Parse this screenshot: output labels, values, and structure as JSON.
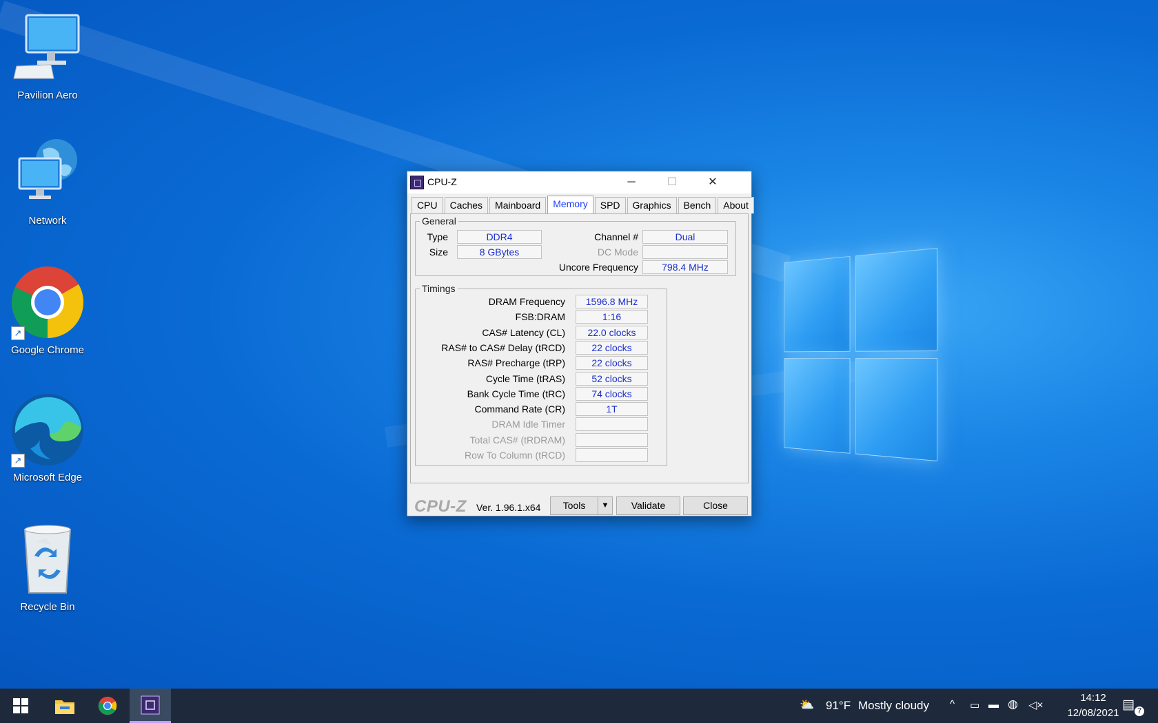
{
  "desktop": {
    "icons": [
      {
        "label": "Pavilion Aero",
        "icon": "computer-icon"
      },
      {
        "label": "Network",
        "icon": "network-icon"
      },
      {
        "label": "Google Chrome",
        "icon": "chrome-icon"
      },
      {
        "label": "Microsoft Edge",
        "icon": "edge-icon"
      },
      {
        "label": "Recycle Bin",
        "icon": "recycle-bin-icon"
      }
    ]
  },
  "window": {
    "title": "CPU-Z",
    "controls": {
      "minimize": "─",
      "maximize": "☐",
      "close": "✕"
    },
    "tabs": [
      "CPU",
      "Caches",
      "Mainboard",
      "Memory",
      "SPD",
      "Graphics",
      "Bench",
      "About"
    ],
    "active_tab": "Memory",
    "general": {
      "legend": "General",
      "type_label": "Type",
      "type_value": "DDR4",
      "size_label": "Size",
      "size_value": "8 GBytes",
      "channel_label": "Channel #",
      "channel_value": "Dual",
      "dcmode_label": "DC Mode",
      "dcmode_value": "",
      "uncore_label": "Uncore Frequency",
      "uncore_value": "798.4 MHz"
    },
    "timings": {
      "legend": "Timings",
      "rows": [
        {
          "label": "DRAM Frequency",
          "value": "1596.8 MHz",
          "enabled": true
        },
        {
          "label": "FSB:DRAM",
          "value": "1:16",
          "enabled": true
        },
        {
          "label": "CAS# Latency (CL)",
          "value": "22.0 clocks",
          "enabled": true
        },
        {
          "label": "RAS# to CAS# Delay (tRCD)",
          "value": "22 clocks",
          "enabled": true
        },
        {
          "label": "RAS# Precharge (tRP)",
          "value": "22 clocks",
          "enabled": true
        },
        {
          "label": "Cycle Time (tRAS)",
          "value": "52 clocks",
          "enabled": true
        },
        {
          "label": "Bank Cycle Time (tRC)",
          "value": "74 clocks",
          "enabled": true
        },
        {
          "label": "Command Rate (CR)",
          "value": "1T",
          "enabled": true
        },
        {
          "label": "DRAM Idle Timer",
          "value": "",
          "enabled": false
        },
        {
          "label": "Total CAS# (tRDRAM)",
          "value": "",
          "enabled": false
        },
        {
          "label": "Row To Column (tRCD)",
          "value": "",
          "enabled": false
        }
      ]
    },
    "footer": {
      "brand": "CPU-Z",
      "version": "Ver. 1.96.1.x64",
      "tools_label": "Tools",
      "validate_label": "Validate",
      "close_label": "Close"
    }
  },
  "taskbar": {
    "apps": [
      "start-icon",
      "file-explorer-icon",
      "chrome-icon",
      "cpuz-icon"
    ],
    "active_app": "cpuz-icon",
    "weather": {
      "temp": "91°F",
      "condition": "Mostly cloudy"
    },
    "clock": {
      "time": "14:12",
      "date": "12/08/2021"
    },
    "notification_count": "7"
  },
  "colors": {
    "accent_tab": "#1a3cff",
    "value_text": "#1a2ecc",
    "taskbar": "#1e2a3c"
  }
}
